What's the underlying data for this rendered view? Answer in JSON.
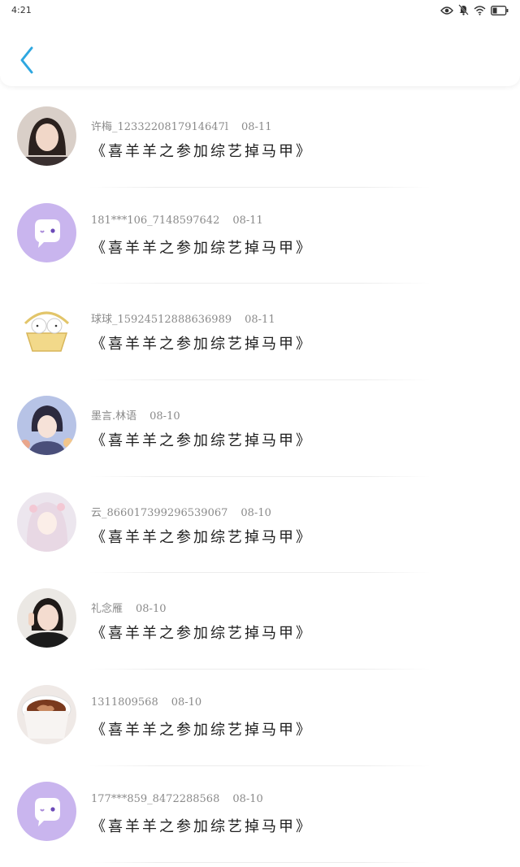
{
  "status_bar": {
    "time": "4:21",
    "icons": [
      "eye-icon",
      "bell-muted-icon",
      "wifi-icon",
      "battery-icon"
    ]
  },
  "header": {
    "back_icon": "chevron-left-icon",
    "accent_color": "#2ea7e0"
  },
  "comments": [
    {
      "username": "许梅_1233220817914647l",
      "date": "08-11",
      "title": "《喜羊羊之参加综艺掉马甲》",
      "avatar": "photo-woman"
    },
    {
      "username": "181***106_7148597642",
      "date": "08-11",
      "title": "《喜羊羊之参加综艺掉马甲》",
      "avatar": "default-chat"
    },
    {
      "username": "球球_1592451288863698​9",
      "date": "08-11",
      "title": "《喜羊羊之参加综艺掉马甲》",
      "avatar": "cartoon-basket"
    },
    {
      "username": "墨言.林语",
      "date": "08-10",
      "title": "《喜羊羊之参加综艺掉马甲》",
      "avatar": "anime-boy"
    },
    {
      "username": "云_866017399296539067",
      "date": "08-10",
      "title": "《喜羊羊之参加综艺掉马甲》",
      "avatar": "anime-girl"
    },
    {
      "username": "礼念雁",
      "date": "08-10",
      "title": "《喜羊羊之参加综艺掉马甲》",
      "avatar": "photo-woman-peace"
    },
    {
      "username": "1311809568",
      "date": "08-10",
      "title": "《喜羊羊之参加综艺掉马甲》",
      "avatar": "coffee-cup"
    },
    {
      "username": "177***859_8472288568",
      "date": "08-10",
      "title": "《喜羊羊之参加综艺掉马甲》",
      "avatar": "default-chat"
    }
  ]
}
